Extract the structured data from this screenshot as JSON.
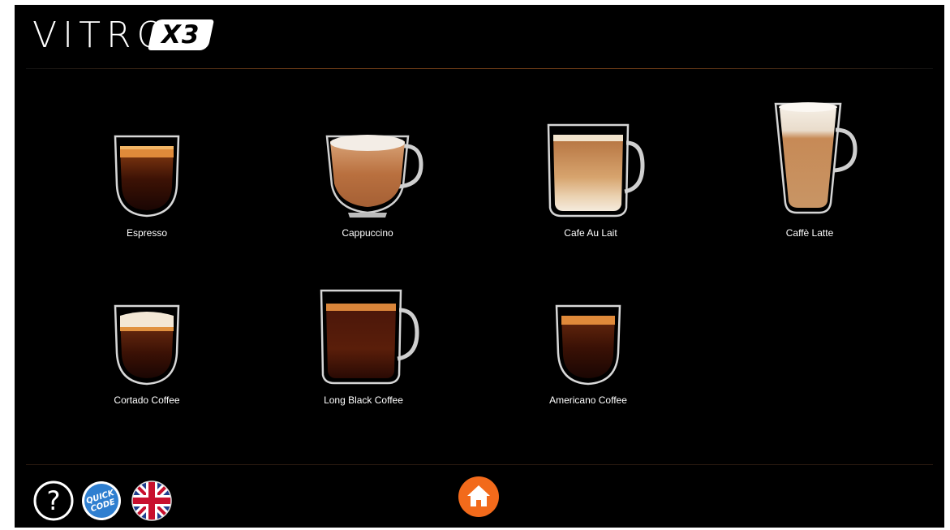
{
  "brand": {
    "logo_text": "VITRO",
    "logo_badge": "X3"
  },
  "products": [
    {
      "label": "Espresso",
      "icon": "espresso-glass-icon"
    },
    {
      "label": "Cappuccino",
      "icon": "cappuccino-cup-icon"
    },
    {
      "label": "Cafe Au Lait",
      "icon": "cafe-au-lait-mug-icon"
    },
    {
      "label": "Caffè Latte",
      "icon": "caffe-latte-glass-icon"
    },
    {
      "label": "Cortado Coffee",
      "icon": "cortado-glass-icon"
    },
    {
      "label": "Long Black Coffee",
      "icon": "long-black-mug-icon"
    },
    {
      "label": "Americano Coffee",
      "icon": "americano-glass-icon"
    }
  ],
  "footer": {
    "help_symbol": "?",
    "quick_code_line1": "QUICK",
    "quick_code_line2": "CODE",
    "language_icon": "uk-flag-icon",
    "home_icon": "home-icon"
  },
  "colors": {
    "background": "#000000",
    "accent_orange": "#f26a1b",
    "quick_code_blue": "#2f7fd0",
    "header_divider": "#6a3a16"
  }
}
